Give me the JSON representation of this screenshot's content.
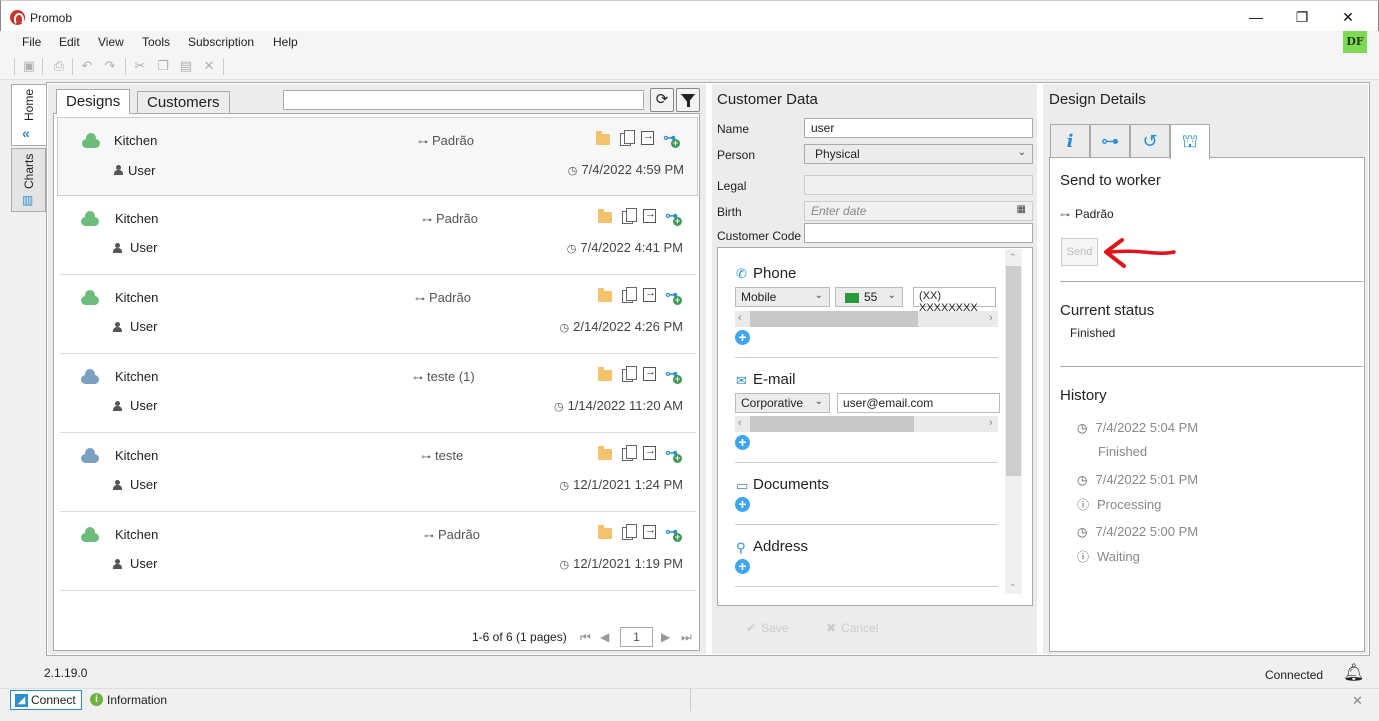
{
  "window": {
    "title": "Promob",
    "minimize": "—",
    "restore": "❐",
    "close": "✕",
    "user_initials": "DF"
  },
  "menu": [
    "File",
    "Edit",
    "View",
    "Tools",
    "Subscription",
    "Help"
  ],
  "side_tabs": {
    "home": "Home",
    "charts": "Charts"
  },
  "designs_panel": {
    "tabs": {
      "designs": "Designs",
      "customers": "Customers"
    },
    "search_placeholder": "",
    "rows": [
      {
        "name": "Kitchen",
        "user": "User",
        "tree": "Padrão",
        "date": "7/4/2022 4:59 PM",
        "cloud_color": "#6cbd7b",
        "selected": true
      },
      {
        "name": "Kitchen",
        "user": "User",
        "tree": "Padrão",
        "date": "7/4/2022 4:41 PM",
        "cloud_color": "#6cbd7b"
      },
      {
        "name": "Kitchen",
        "user": "User",
        "tree": "Padrão",
        "date": "2/14/2022 4:26 PM",
        "cloud_color": "#6cbd7b"
      },
      {
        "name": "Kitchen",
        "user": "User",
        "tree": "teste (1)",
        "date": "1/14/2022 11:20 AM",
        "cloud_color": "#7a9fc0"
      },
      {
        "name": "Kitchen",
        "user": "User",
        "tree": "teste",
        "date": "12/1/2021 1:24 PM",
        "cloud_color": "#7a9fc0"
      },
      {
        "name": "Kitchen",
        "user": "User",
        "tree": "Padrão",
        "date": "12/1/2021 1:19 PM",
        "cloud_color": "#6cbd7b"
      }
    ],
    "pager": {
      "summary": "1-6 of 6 (1 pages)",
      "page": "1"
    }
  },
  "customer": {
    "title": "Customer Data",
    "labels": {
      "name": "Name",
      "person": "Person",
      "legal": "Legal",
      "birth": "Birth",
      "code": "Customer Code"
    },
    "values": {
      "name": "user",
      "person": "Physical",
      "legal": "",
      "birth_placeholder": "Enter date",
      "code": ""
    },
    "phone": {
      "title": "Phone",
      "type": "Mobile",
      "country_code": "55",
      "number": "(XX) XXXXXXXX"
    },
    "email": {
      "title": "E-mail",
      "type": "Corporative",
      "address": "user@email.com"
    },
    "documents": {
      "title": "Documents"
    },
    "address": {
      "title": "Address"
    },
    "save": "Save",
    "cancel": "Cancel"
  },
  "details": {
    "title": "Design Details",
    "send_to_worker": "Send to worker",
    "tree": "Padrão",
    "send_button": "Send",
    "current_status_label": "Current status",
    "current_status": "Finished",
    "history_label": "History",
    "history": [
      {
        "date": "7/4/2022 5:04 PM",
        "status": "Finished"
      },
      {
        "date": "7/4/2022 5:01 PM",
        "status": "Processing"
      },
      {
        "date": "7/4/2022 5:00 PM",
        "status": "Waiting"
      }
    ]
  },
  "statusbar": {
    "version": "2.1.19.0",
    "connection": "Connected"
  },
  "bottombar": {
    "connect": "Connect",
    "information": "Information"
  },
  "colors": {
    "accent": "#2b8fcf",
    "arrow": "#e0141b",
    "badge": "#7ed957"
  }
}
